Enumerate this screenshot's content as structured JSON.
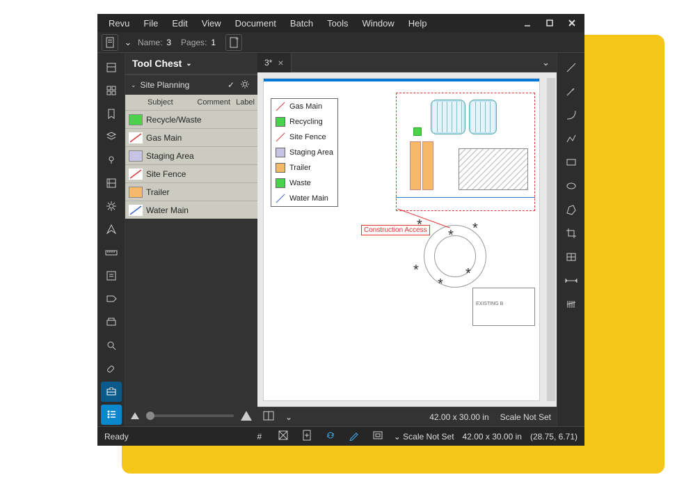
{
  "menu": [
    "Revu",
    "File",
    "Edit",
    "View",
    "Document",
    "Batch",
    "Tools",
    "Window",
    "Help"
  ],
  "infobar": {
    "name_label": "Name:",
    "name_value": "3",
    "pages_label": "Pages:",
    "pages_value": "1"
  },
  "panel": {
    "title": "Tool Chest",
    "section": "Site Planning",
    "columns": {
      "subject": "Subject",
      "comment": "Comment",
      "label": "Label"
    },
    "items": [
      {
        "subject": "Recycle/Waste",
        "color": "#4ad24a",
        "type": "fill"
      },
      {
        "subject": "Gas Main",
        "color": "#d63a3a",
        "type": "line"
      },
      {
        "subject": "Staging Area",
        "color": "#c7c3e6",
        "type": "fill"
      },
      {
        "subject": "Site Fence",
        "color": "#d63a3a",
        "type": "line"
      },
      {
        "subject": "Trailer",
        "color": "#f5b968",
        "type": "fill"
      },
      {
        "subject": "Water Main",
        "color": "#3a66c7",
        "type": "line"
      }
    ]
  },
  "tab": {
    "label": "3*"
  },
  "legend": [
    {
      "label": "Gas Main",
      "color": "#d63a3a",
      "type": "line"
    },
    {
      "label": "Recycling",
      "color": "#4ad24a",
      "type": "fill"
    },
    {
      "label": "Site Fence",
      "color": "#d63a3a",
      "type": "line"
    },
    {
      "label": "Staging Area",
      "color": "#c7c3e6",
      "type": "fill"
    },
    {
      "label": "Trailer",
      "color": "#f5b968",
      "type": "fill"
    },
    {
      "label": "Waste",
      "color": "#4ad24a",
      "type": "fill"
    },
    {
      "label": "Water Main",
      "color": "#3a66c7",
      "type": "line"
    }
  ],
  "annotation": {
    "construction_access": "Construction Access"
  },
  "docfoot": {
    "size": "42.00 x 30.00 in",
    "scale": "Scale Not Set"
  },
  "status": {
    "ready": "Ready",
    "scale_prefix": "Scale Not Set",
    "size": "42.00 x 30.00 in",
    "cursor": "(28.75, 6.71)"
  },
  "site_label": {
    "existing": "EXISTING B"
  }
}
